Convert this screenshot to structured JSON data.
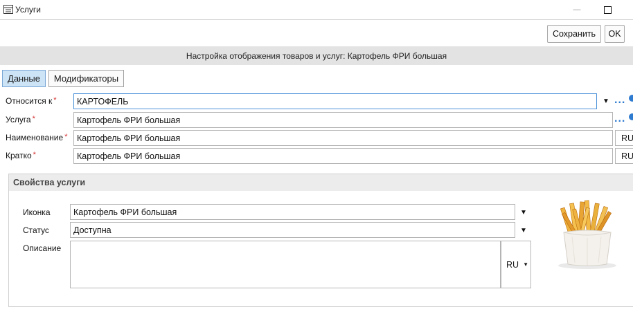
{
  "window": {
    "title": "Услуги",
    "app_icon": "window-list-icon",
    "minimize_glyph": "—",
    "maximize_glyph": "☐"
  },
  "toolbar": {
    "save_label": "Сохранить",
    "ok_label": "OK"
  },
  "header": {
    "text": "Настройка отображения товаров и услуг:  Картофель ФРИ  большая"
  },
  "tabs": [
    {
      "label": "Данные",
      "active": true
    },
    {
      "label": "Модификаторы",
      "active": false
    }
  ],
  "form": {
    "belongs_to": {
      "label": "Относится к",
      "required_mark": "*",
      "value": "КАРТОФЕЛЬ"
    },
    "service": {
      "label": "Услуга",
      "required_mark": "*",
      "value": "Картофель ФРИ  большая"
    },
    "name": {
      "label": "Наименование",
      "required_mark": "*",
      "value": "Картофель ФРИ  большая",
      "lang": "RU"
    },
    "short": {
      "label": "Кратко",
      "required_mark": "*",
      "value": "Картофель ФРИ  большая",
      "lang": "RU"
    }
  },
  "properties": {
    "title": "Свойства услуги",
    "icon": {
      "label": "Иконка",
      "value": "Картофель ФРИ  большая"
    },
    "status": {
      "label": "Статус",
      "value": "Доступна"
    },
    "description": {
      "label": "Описание",
      "value": "",
      "lang": "RU"
    }
  },
  "glyphs": {
    "dropdown": "▼",
    "ellipsis": "..."
  }
}
